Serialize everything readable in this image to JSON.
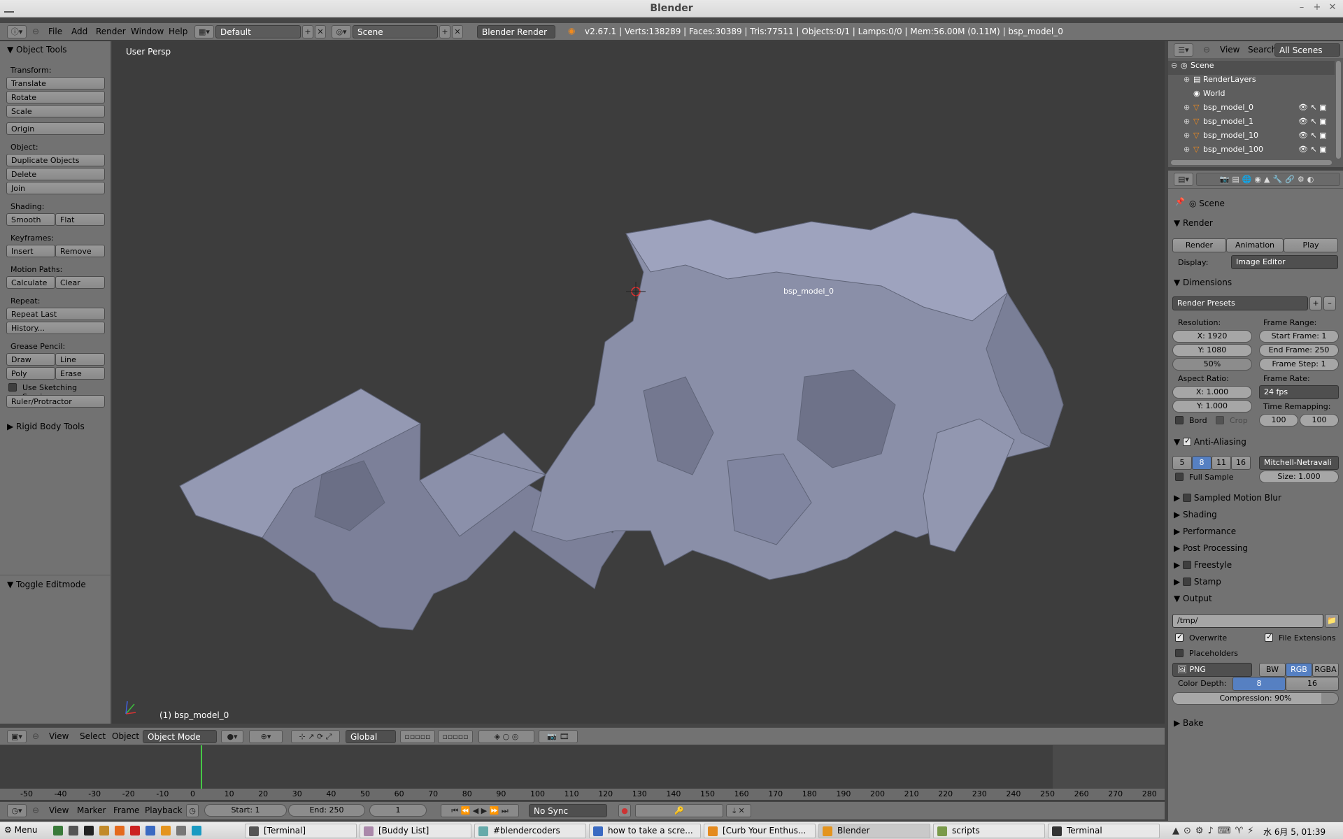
{
  "window": {
    "title": "Blender"
  },
  "info_header": {
    "menus": [
      "File",
      "Add",
      "Render",
      "Window",
      "Help"
    ],
    "screen_layout": "Default",
    "scene": "Scene",
    "render_engine": "Blender Render",
    "stats": "v2.67.1 | Verts:138289 | Faces:30389 | Tris:77511 | Objects:0/1 | Lamps:0/0 | Mem:56.00M (0.11M) | bsp_model_0"
  },
  "tool_shelf": {
    "title": "Object Tools",
    "transform_label": "Transform:",
    "translate": "Translate",
    "rotate": "Rotate",
    "scale": "Scale",
    "origin": "Origin",
    "object_label": "Object:",
    "duplicate": "Duplicate Objects",
    "delete": "Delete",
    "join": "Join",
    "shading_label": "Shading:",
    "smooth": "Smooth",
    "flat": "Flat",
    "keyframes_label": "Keyframes:",
    "insert": "Insert",
    "remove": "Remove",
    "motion_label": "Motion Paths:",
    "calculate": "Calculate",
    "clear": "Clear",
    "repeat_label": "Repeat:",
    "repeat_last": "Repeat Last",
    "history": "History...",
    "grease_label": "Grease Pencil:",
    "draw": "Draw",
    "line": "Line",
    "poly": "Poly",
    "erase": "Erase",
    "sketching": "Use Sketching Sessions",
    "ruler": "Ruler/Protractor",
    "rigid": "Rigid Body Tools",
    "toggle_edit": "Toggle Editmode"
  },
  "viewport": {
    "label": "User Persp",
    "object_label": "(1) bsp_model_0",
    "origin_label": "bsp_model_0"
  },
  "view_header": {
    "menus": [
      "View",
      "Select",
      "Object"
    ],
    "mode": "Object Mode",
    "orientation": "Global"
  },
  "timeline": {
    "ticks": [
      "-50",
      "-40",
      "-30",
      "-20",
      "-10",
      "0",
      "10",
      "20",
      "30",
      "40",
      "50",
      "60",
      "70",
      "80",
      "90",
      "100",
      "110",
      "120",
      "130",
      "140",
      "150",
      "160",
      "170",
      "180",
      "190",
      "200",
      "210",
      "220",
      "230",
      "240",
      "250",
      "260",
      "270",
      "280"
    ],
    "menus": [
      "View",
      "Marker",
      "Frame",
      "Playback"
    ],
    "start": "Start: 1",
    "end": "End: 250",
    "current": "1",
    "sync": "No Sync",
    "current_frame_value": 1
  },
  "outliner": {
    "menus": [
      "View",
      "Search"
    ],
    "filter": "All Scenes",
    "items": [
      "Scene",
      "RenderLayers",
      "World",
      "bsp_model_0",
      "bsp_model_1",
      "bsp_model_10",
      "bsp_model_100"
    ]
  },
  "properties": {
    "context": "Scene",
    "render": {
      "title": "Render",
      "render_btn": "Render",
      "animation_btn": "Animation",
      "play_btn": "Play",
      "display_label": "Display:",
      "display": "Image Editor"
    },
    "dimensions": {
      "title": "Dimensions",
      "presets": "Render Presets",
      "resolution_label": "Resolution:",
      "res_x": "X: 1920",
      "res_y": "Y: 1080",
      "res_pct": "50%",
      "frame_range_label": "Frame Range:",
      "start": "Start Frame: 1",
      "end": "End Frame: 250",
      "step": "Frame Step: 1",
      "aspect_label": "Aspect Ratio:",
      "asp_x": "X: 1.000",
      "asp_y": "Y: 1.000",
      "frame_rate_label": "Frame Rate:",
      "fps": "24 fps",
      "remap_label": "Time Remapping:",
      "remap_old": "100",
      "remap_new": "100",
      "bord": "Bord",
      "crop": "Crop"
    },
    "aa": {
      "title": "Anti-Aliasing",
      "samples": [
        "5",
        "8",
        "11",
        "16"
      ],
      "selected": "8",
      "filter": "Mitchell-Netravali",
      "full_sample": "Full Sample",
      "size": "Size: 1.000"
    },
    "collapsed": [
      "Sampled Motion Blur",
      "Shading",
      "Performance",
      "Post Processing",
      "Freestyle",
      "Stamp"
    ],
    "output": {
      "title": "Output",
      "path": "/tmp/",
      "overwrite": "Overwrite",
      "file_ext": "File Extensions",
      "placeholders": "Placeholders",
      "format": "PNG",
      "modes": [
        "BW",
        "RGB",
        "RGBA"
      ],
      "selected_mode": "RGB",
      "depth_label": "Color Depth:",
      "depths": [
        "8",
        "16"
      ],
      "selected_depth": "8",
      "compression": "Compression: 90%",
      "compression_value": 0.9
    },
    "bake": "Bake"
  },
  "taskbar": {
    "menu": "Menu",
    "tasks": [
      "[Terminal]",
      "[Buddy List]",
      "#blendercoders",
      "how to take a scre...",
      "[Curb Your Enthus...",
      "Blender",
      "scripts",
      "Terminal"
    ],
    "clock": "水 6月 5, 01:39"
  },
  "colors": {
    "accent": "#5680c2",
    "mesh": "#8a8fa8",
    "viewport_bg": "#3d3d3d",
    "panel": "#727272"
  }
}
